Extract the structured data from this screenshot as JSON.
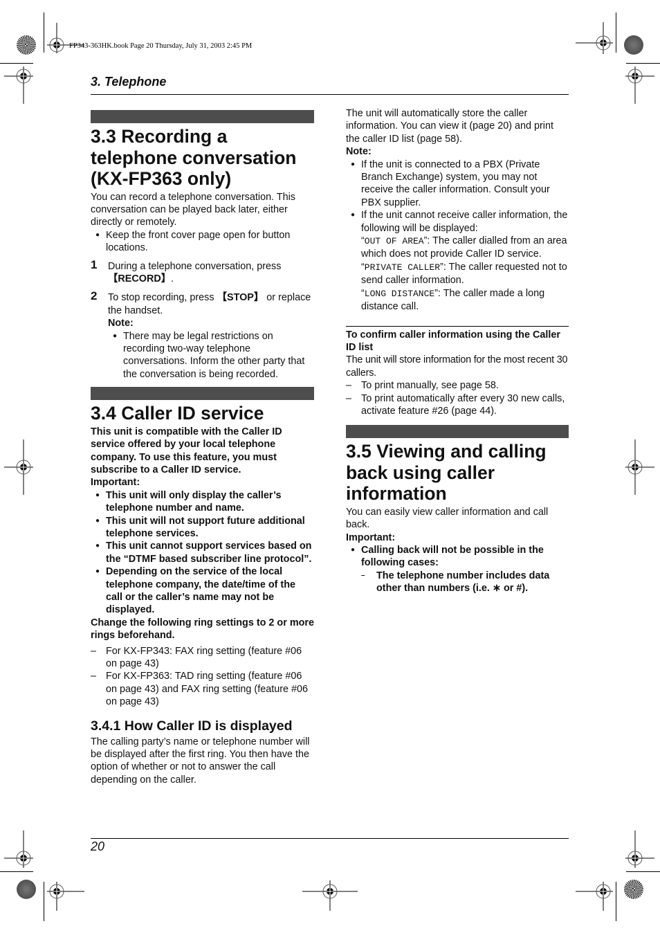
{
  "print_header": {
    "book_info": "FP343-363HK.book  Page 20  Thursday, July 31, 2003  2:45 PM"
  },
  "chapter_title": "3. Telephone",
  "page_number": "20",
  "left_column": {
    "sec33": {
      "title": "3.3 Recording a telephone conversation (KX-FP363 only)",
      "intro": "You can record a telephone conversation. This conversation can be played back later, either directly or remotely.",
      "bullets": [
        "Keep the front cover page open for button locations."
      ],
      "steps": [
        {
          "num": "1",
          "text": "During a telephone conversation, press ",
          "key": "【RECORD】",
          "after": "."
        },
        {
          "num": "2",
          "text": "To stop recording, press ",
          "key": "【STOP】",
          "after": " or replace the handset."
        }
      ],
      "note_label": "Note:",
      "note_bullets": [
        "There may be legal restrictions on recording two-way telephone conversations. Inform the other party that the conversation is being recorded."
      ]
    },
    "sec34": {
      "title": "3.4 Caller ID service",
      "intro_bold": "This unit is compatible with the Caller ID service offered by your local telephone company. To use this feature, you must subscribe to a Caller ID service.",
      "important_label": "Important:",
      "important_bullets": [
        "This unit will only display the caller’s telephone number and name.",
        "This unit will not support future additional telephone services.",
        "This unit cannot support services based on the “DTMF based subscriber line protocol”.",
        "Depending on the service of the local telephone company, the date/time of the call or the caller’s name may not be displayed."
      ],
      "ring_note": "Change the following ring settings to 2 or more rings beforehand.",
      "ring_items": [
        "For KX-FP343: FAX ring setting (feature #06 on page 43)",
        "For KX-FP363: TAD ring setting (feature #06 on page 43) and FAX ring setting (feature #06 on page 43)"
      ]
    },
    "sec341": {
      "title": "3.4.1 How Caller ID is displayed",
      "body": "The calling party’s name or telephone number will be displayed after the first ring. You then have the option of whether or not to answer the call depending on the caller."
    }
  },
  "right_column": {
    "intro": "The unit will automatically store the caller information. You can view it (page 20) and print the caller ID list (page 58).",
    "note_label": "Note:",
    "note_bullet_1": "If the unit is connected to a PBX (Private Branch Exchange) system, you may not receive the caller information. Consult your PBX supplier.",
    "note_bullet_2": "If the unit cannot receive caller information, the following will be displayed:",
    "display_messages": [
      {
        "code": "OUT OF AREA",
        "desc": ": The caller dialled from an area which does not provide Caller ID service."
      },
      {
        "code": "PRIVATE CALLER",
        "desc": ": The caller requested not to send caller information."
      },
      {
        "code": "LONG DISTANCE",
        "desc": ": The caller made a long distance call."
      }
    ],
    "confirm_heading": "To confirm caller information using the Caller ID list",
    "confirm_body": "The unit will store information for the most recent 30 callers.",
    "confirm_items": [
      "To print manually, see page 58.",
      "To print automatically after every 30 new calls, activate feature #26 (page 44)."
    ],
    "sec35": {
      "title": "3.5 Viewing and calling back using caller information",
      "intro": "You can easily view caller information and call back.",
      "important_label": "Important:",
      "bullet": "Calling back will not be possible in the following cases:",
      "sub_items": [
        "The telephone number includes data other than numbers (i.e. ∗ or #)."
      ]
    }
  }
}
